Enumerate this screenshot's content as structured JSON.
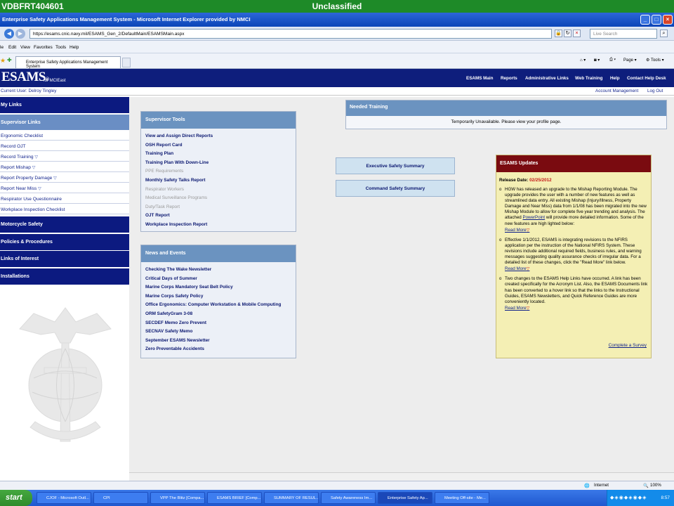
{
  "banner": {
    "host": "VDBFRT404601",
    "classification": "Unclassified"
  },
  "window": {
    "title": "Enterprise Safety Applications Management System - Microsoft Internet Explorer provided by NMCI"
  },
  "address": {
    "url": "https://esams.cnic.navy.mil/ESAMS_Gen_2/DefaultMain/ESAMSMain.aspx",
    "search_placeholder": "Live Search"
  },
  "menu": [
    "le",
    "Edit",
    "View",
    "Favorites",
    "Tools",
    "Help"
  ],
  "tab": {
    "label": "Enterprise Safety Applications Management System"
  },
  "toolbar": {
    "page": "Page",
    "tools": "Tools"
  },
  "header": {
    "logo": "ESAMS",
    "reg": "®",
    "logo_sub": "for MCIEast",
    "nav": [
      "ESAMS Main",
      "Reports",
      "Administrative Links",
      "Web Training",
      "Help",
      "Contact Help Desk"
    ],
    "current_user": "Current User: Delroy Tingley",
    "account": "Account Management",
    "logout": "Log Out"
  },
  "leftnav": {
    "my_links": "My Links",
    "supervisor_links": "Supervisor Links",
    "items": [
      {
        "label": "Ergonomic Checklist",
        "arrow": ""
      },
      {
        "label": "Record OJT",
        "arrow": ""
      },
      {
        "label": "Record Training",
        "arrow": "▽"
      },
      {
        "label": "Report Mishap",
        "arrow": "▽"
      },
      {
        "label": "Report Property Damage",
        "arrow": "▽"
      },
      {
        "label": "Report Near Miss",
        "arrow": "▽"
      },
      {
        "label": "Respirator Use Questionnaire",
        "arrow": ""
      },
      {
        "label": "Workplace Inspection Checklist",
        "arrow": ""
      }
    ],
    "sections": [
      "Motorcycle Safety",
      "Policies & Procedures",
      "Links of Interest",
      "Installations"
    ]
  },
  "supervisor_tools": {
    "title": "Supervisor Tools",
    "links": [
      {
        "label": "View and Assign Direct Reports",
        "enabled": true
      },
      {
        "label": "OSH Report Card",
        "enabled": true
      },
      {
        "label": "Training Plan",
        "enabled": true
      },
      {
        "label": "Training Plan With Down-Line",
        "enabled": true
      },
      {
        "label": "PPE Requirements",
        "enabled": false
      },
      {
        "label": "Monthly Safety Talks Report",
        "enabled": true
      },
      {
        "label": "Respirator Workers",
        "enabled": false
      },
      {
        "label": "Medical Surveillance Programs",
        "enabled": false
      },
      {
        "label": "Duty/Task Report",
        "enabled": false
      },
      {
        "label": "OJT Report",
        "enabled": true
      },
      {
        "label": "Workplace Inspection Report",
        "enabled": true
      }
    ]
  },
  "news": {
    "title": "News and Events",
    "links": [
      "Checking The Wake Newsletter",
      "Critical Days of Summer",
      "Marine Corps Mandatory Seat Belt Policy",
      "Marine Corps Safety Policy",
      "Office Ergonomics: Computer Workstation & Mobile Computing",
      "ORM SafetyGram 3-08",
      "SECDEF Memo Zero Prevent",
      "SECNAV Safety Memo",
      "September ESAMS Newsletter",
      "Zero Preventable Accidents"
    ]
  },
  "summaries": {
    "executive": "Executive Safety Summary",
    "command": "Command Safety Summary"
  },
  "needed_training": {
    "title": "Needed Training",
    "message": "Temporarily Unavailable. Please view your profile page."
  },
  "updates": {
    "title": "ESAMS Updates",
    "release_label": "Release Date:",
    "release_date": "02/25/2012",
    "items": [
      {
        "text": "HGW has released an upgrade to the Mishap Reporting Module. The upgrade provides the user with a number of new features as well as streamlined data entry. All existing Mishap (Injury/Illness, Property Damage and Near Miss) data from 1/1/08 has been migrated into the new Mishap Module to allow for complete five year trending and analysis. The attached ",
        "link": "PowerPoint",
        "text2": " will provide more detailed information. Some of the new features are high lighted below:"
      },
      {
        "text": "Effective 1/1/2012, ESAMS is integrating revisions to the NFIRS application per the instruction of the National NFIRS System. These revisions include additional required fields, business rules, and warning messages suggesting quality assurance checks of irregular data. For a detailed list of these changes, click the \"Read More\" link below.",
        "link": "",
        "text2": ""
      },
      {
        "text": "Two changes to the ESAMS Help Links have occurred. A link has been created specifically for the Acronym List. Also, the ESAMS Documents link has been converted to a hover link so that the links to the Instructional Guides, ESAMS Newsletters, and Quick Reference Guides are more conveniently located.",
        "link": "",
        "text2": ""
      }
    ],
    "read_more": "Read More",
    "survey": "Complete a Survey"
  },
  "statusbar": {
    "zone": "Internet",
    "zoom": "100%"
  },
  "taskbar": {
    "start": "start",
    "tasks": [
      "CJOF - Microsoft Outl...",
      "CPI",
      "VPP The Blitz [Compa...",
      "ESAMS BRIEF [Comp...",
      "SUMMARY OF RESUL...",
      "Safety Awareness Im...",
      "Enterprise Safety Ap...",
      "Meeting Off-site - Me..."
    ],
    "clock": "8:57"
  },
  "colors": {
    "banner": "#1e8a28",
    "header": "#0e1e7c",
    "panel_header": "#6b93c0",
    "updates_header": "#7a0b10",
    "updates_bg": "#f4efb4"
  }
}
